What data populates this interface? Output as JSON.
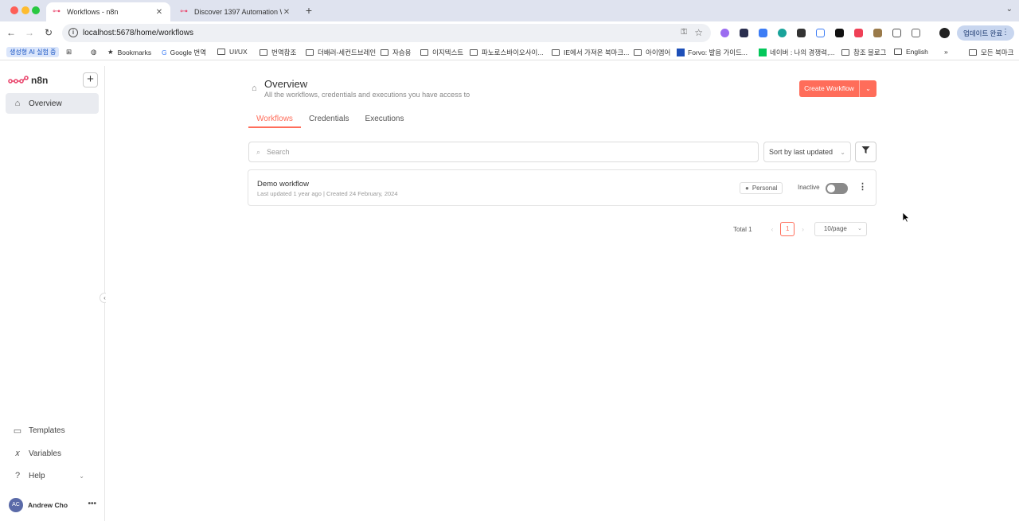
{
  "browser": {
    "tabs": [
      {
        "title": "Workflows - n8n",
        "active": true
      },
      {
        "title": "Discover 1397 Automation W",
        "active": false
      }
    ],
    "url": "localhost:5678/home/workflows",
    "update_button": "업데이트 완료",
    "bookmarks": [
      "생성형 AI 실험 중",
      "Bookmarks",
      "Google 번역",
      "UI/UX",
      "번역참조",
      "더배러-세컨드브레인",
      "자습용",
      "이지텍스트",
      "파노로스바이오사이...",
      "IE에서 가져온 북마크...",
      "아이엠어",
      "Forvo: 발음 가이드...",
      "네이버 : 나의 경쟁력,...",
      "참조 블로그",
      "English",
      "모든 북마크"
    ]
  },
  "sidebar": {
    "brand": "n8n",
    "nav": [
      {
        "label": "Overview",
        "icon": "home-icon",
        "active": true
      }
    ],
    "bottom": [
      {
        "label": "Templates",
        "icon": "templates-icon"
      },
      {
        "label": "Variables",
        "icon": "variables-icon"
      },
      {
        "label": "Help",
        "icon": "help-icon"
      }
    ],
    "user": {
      "initials": "AC",
      "name": "Andrew Cho"
    }
  },
  "main": {
    "title": "Overview",
    "subtitle": "All the workflows, credentials and executions you have access to",
    "create_button": "Create Workflow",
    "tabs": [
      {
        "label": "Workflows",
        "active": true
      },
      {
        "label": "Credentials",
        "active": false
      },
      {
        "label": "Executions",
        "active": false
      }
    ],
    "search": {
      "placeholder": "Search",
      "value": ""
    },
    "sort": "Sort by last updated",
    "workflows": [
      {
        "name": "Demo workflow",
        "meta": "Last updated 1 year ago | Created 24 February, 2024",
        "owner": "Personal",
        "status": "Inactive",
        "active": false
      }
    ],
    "pagination": {
      "total": "Total 1",
      "current_page": "1",
      "per_page": "10/page"
    }
  },
  "colors": {
    "accent": "#ff6d5a",
    "sidebar_active": "#e9ebf0",
    "toggle_off": "#8a8a8a"
  }
}
